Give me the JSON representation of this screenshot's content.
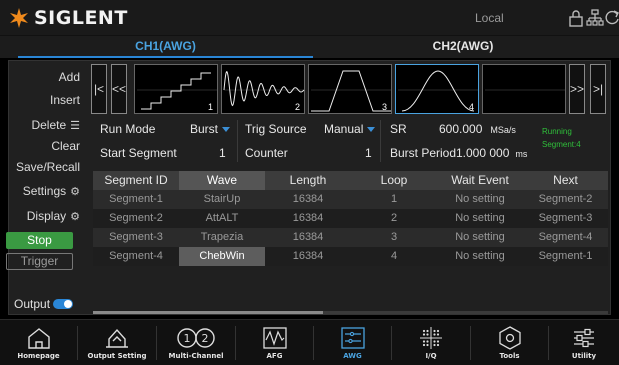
{
  "brand": "SIGLENT",
  "status": {
    "mode": "Local"
  },
  "channels": {
    "ch1": "CH1(AWG)",
    "ch2": "CH2(AWG)"
  },
  "menu": {
    "add": "Add",
    "insert": "Insert",
    "delete": "Delete",
    "clear": "Clear",
    "save_recall": "Save/Recall",
    "settings": "Settings",
    "display": "Display",
    "stop": "Stop",
    "trigger": "Trigger",
    "output": "Output",
    "output_on": true
  },
  "nav": {
    "first": "|<",
    "prev": "<<",
    "next": ">>",
    "last": ">|"
  },
  "segments": [
    {
      "num": "1",
      "shape": "stair-up"
    },
    {
      "num": "2",
      "shape": "att-alt"
    },
    {
      "num": "3",
      "shape": "trapezia"
    },
    {
      "num": "4",
      "shape": "cheb-win"
    },
    {
      "num": "",
      "shape": "empty"
    }
  ],
  "params": {
    "run_mode_label": "Run Mode",
    "run_mode_value": "Burst",
    "trig_source_label": "Trig Source",
    "trig_source_value": "Manual",
    "sr_label": "SR",
    "sr_value": "600.000",
    "sr_unit": "MSa/s",
    "start_segment_label": "Start Segment",
    "start_segment_value": "1",
    "counter_label": "Counter",
    "counter_value": "1",
    "burst_period_label": "Burst Period",
    "burst_period_value": "1.000 000",
    "burst_period_unit": "ms",
    "running_line1": "Running",
    "running_line2": "Segment:4"
  },
  "table": {
    "headers": [
      "Segment ID",
      "Wave",
      "Length",
      "Loop",
      "Wait Event",
      "Next"
    ],
    "rows": [
      [
        "Segment-1",
        "StairUp",
        "16384",
        "1",
        "No setting",
        "Segment-2"
      ],
      [
        "Segment-2",
        "AttALT",
        "16384",
        "2",
        "No setting",
        "Segment-3"
      ],
      [
        "Segment-3",
        "Trapezia",
        "16384",
        "3",
        "No setting",
        "Segment-4"
      ],
      [
        "Segment-4",
        "ChebWin",
        "16384",
        "4",
        "No setting",
        "Segment-1"
      ]
    ]
  },
  "dock": [
    {
      "label": "Homepage",
      "icon": "home-icon"
    },
    {
      "label": "Output Setting",
      "icon": "output-setting-icon"
    },
    {
      "label": "Multi-Channel",
      "icon": "multi-channel-icon"
    },
    {
      "label": "AFG",
      "icon": "afg-icon"
    },
    {
      "label": "AWG",
      "icon": "awg-icon",
      "active": true
    },
    {
      "label": "I/Q",
      "icon": "iq-icon"
    },
    {
      "label": "Tools",
      "icon": "tools-icon"
    },
    {
      "label": "Utility",
      "icon": "utility-icon"
    }
  ],
  "colors": {
    "accent": "#2a86d6",
    "run": "#2fbf3a",
    "stop_bg": "#3a9a42"
  }
}
